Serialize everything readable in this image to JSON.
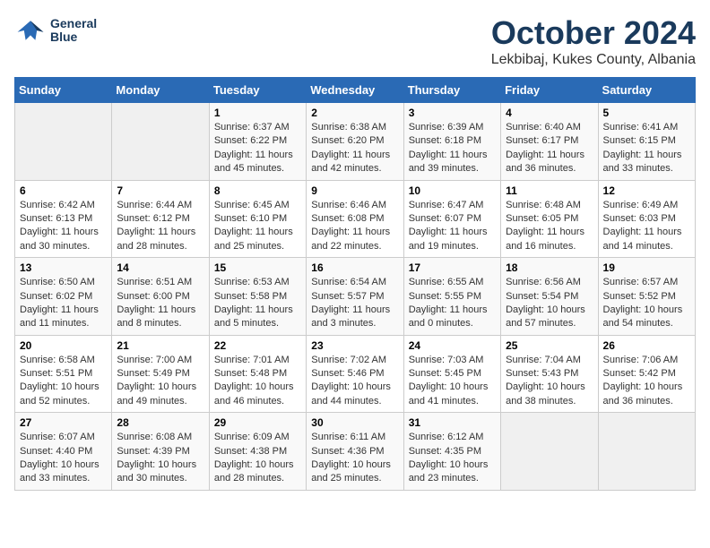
{
  "header": {
    "logo_line1": "General",
    "logo_line2": "Blue",
    "title": "October 2024",
    "subtitle": "Lekbibaj, Kukes County, Albania"
  },
  "weekdays": [
    "Sunday",
    "Monday",
    "Tuesday",
    "Wednesday",
    "Thursday",
    "Friday",
    "Saturday"
  ],
  "weeks": [
    [
      {
        "day": "",
        "empty": true
      },
      {
        "day": "",
        "empty": true
      },
      {
        "day": "1",
        "sunrise": "6:37 AM",
        "sunset": "6:22 PM",
        "daylight": "11 hours and 45 minutes."
      },
      {
        "day": "2",
        "sunrise": "6:38 AM",
        "sunset": "6:20 PM",
        "daylight": "11 hours and 42 minutes."
      },
      {
        "day": "3",
        "sunrise": "6:39 AM",
        "sunset": "6:18 PM",
        "daylight": "11 hours and 39 minutes."
      },
      {
        "day": "4",
        "sunrise": "6:40 AM",
        "sunset": "6:17 PM",
        "daylight": "11 hours and 36 minutes."
      },
      {
        "day": "5",
        "sunrise": "6:41 AM",
        "sunset": "6:15 PM",
        "daylight": "11 hours and 33 minutes."
      }
    ],
    [
      {
        "day": "6",
        "sunrise": "6:42 AM",
        "sunset": "6:13 PM",
        "daylight": "11 hours and 30 minutes."
      },
      {
        "day": "7",
        "sunrise": "6:44 AM",
        "sunset": "6:12 PM",
        "daylight": "11 hours and 28 minutes."
      },
      {
        "day": "8",
        "sunrise": "6:45 AM",
        "sunset": "6:10 PM",
        "daylight": "11 hours and 25 minutes."
      },
      {
        "day": "9",
        "sunrise": "6:46 AM",
        "sunset": "6:08 PM",
        "daylight": "11 hours and 22 minutes."
      },
      {
        "day": "10",
        "sunrise": "6:47 AM",
        "sunset": "6:07 PM",
        "daylight": "11 hours and 19 minutes."
      },
      {
        "day": "11",
        "sunrise": "6:48 AM",
        "sunset": "6:05 PM",
        "daylight": "11 hours and 16 minutes."
      },
      {
        "day": "12",
        "sunrise": "6:49 AM",
        "sunset": "6:03 PM",
        "daylight": "11 hours and 14 minutes."
      }
    ],
    [
      {
        "day": "13",
        "sunrise": "6:50 AM",
        "sunset": "6:02 PM",
        "daylight": "11 hours and 11 minutes."
      },
      {
        "day": "14",
        "sunrise": "6:51 AM",
        "sunset": "6:00 PM",
        "daylight": "11 hours and 8 minutes."
      },
      {
        "day": "15",
        "sunrise": "6:53 AM",
        "sunset": "5:58 PM",
        "daylight": "11 hours and 5 minutes."
      },
      {
        "day": "16",
        "sunrise": "6:54 AM",
        "sunset": "5:57 PM",
        "daylight": "11 hours and 3 minutes."
      },
      {
        "day": "17",
        "sunrise": "6:55 AM",
        "sunset": "5:55 PM",
        "daylight": "11 hours and 0 minutes."
      },
      {
        "day": "18",
        "sunrise": "6:56 AM",
        "sunset": "5:54 PM",
        "daylight": "10 hours and 57 minutes."
      },
      {
        "day": "19",
        "sunrise": "6:57 AM",
        "sunset": "5:52 PM",
        "daylight": "10 hours and 54 minutes."
      }
    ],
    [
      {
        "day": "20",
        "sunrise": "6:58 AM",
        "sunset": "5:51 PM",
        "daylight": "10 hours and 52 minutes."
      },
      {
        "day": "21",
        "sunrise": "7:00 AM",
        "sunset": "5:49 PM",
        "daylight": "10 hours and 49 minutes."
      },
      {
        "day": "22",
        "sunrise": "7:01 AM",
        "sunset": "5:48 PM",
        "daylight": "10 hours and 46 minutes."
      },
      {
        "day": "23",
        "sunrise": "7:02 AM",
        "sunset": "5:46 PM",
        "daylight": "10 hours and 44 minutes."
      },
      {
        "day": "24",
        "sunrise": "7:03 AM",
        "sunset": "5:45 PM",
        "daylight": "10 hours and 41 minutes."
      },
      {
        "day": "25",
        "sunrise": "7:04 AM",
        "sunset": "5:43 PM",
        "daylight": "10 hours and 38 minutes."
      },
      {
        "day": "26",
        "sunrise": "7:06 AM",
        "sunset": "5:42 PM",
        "daylight": "10 hours and 36 minutes."
      }
    ],
    [
      {
        "day": "27",
        "sunrise": "6:07 AM",
        "sunset": "4:40 PM",
        "daylight": "10 hours and 33 minutes."
      },
      {
        "day": "28",
        "sunrise": "6:08 AM",
        "sunset": "4:39 PM",
        "daylight": "10 hours and 30 minutes."
      },
      {
        "day": "29",
        "sunrise": "6:09 AM",
        "sunset": "4:38 PM",
        "daylight": "10 hours and 28 minutes."
      },
      {
        "day": "30",
        "sunrise": "6:11 AM",
        "sunset": "4:36 PM",
        "daylight": "10 hours and 25 minutes."
      },
      {
        "day": "31",
        "sunrise": "6:12 AM",
        "sunset": "4:35 PM",
        "daylight": "10 hours and 23 minutes."
      },
      {
        "day": "",
        "empty": true
      },
      {
        "day": "",
        "empty": true
      }
    ]
  ],
  "labels": {
    "sunrise": "Sunrise:",
    "sunset": "Sunset:",
    "daylight": "Daylight:"
  }
}
